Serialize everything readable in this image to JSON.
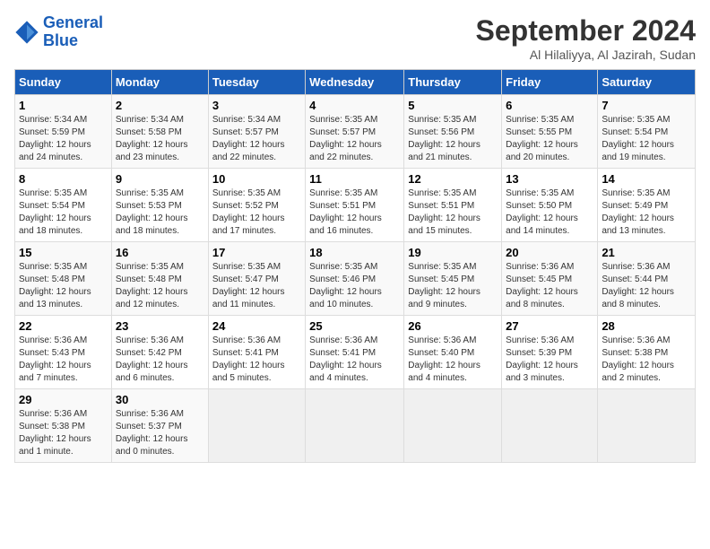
{
  "logo": {
    "line1": "General",
    "line2": "Blue"
  },
  "title": "September 2024",
  "location": "Al Hilaliyya, Al Jazirah, Sudan",
  "weekdays": [
    "Sunday",
    "Monday",
    "Tuesday",
    "Wednesday",
    "Thursday",
    "Friday",
    "Saturday"
  ],
  "weeks": [
    [
      {
        "day": "1",
        "info": "Sunrise: 5:34 AM\nSunset: 5:59 PM\nDaylight: 12 hours\nand 24 minutes."
      },
      {
        "day": "2",
        "info": "Sunrise: 5:34 AM\nSunset: 5:58 PM\nDaylight: 12 hours\nand 23 minutes."
      },
      {
        "day": "3",
        "info": "Sunrise: 5:34 AM\nSunset: 5:57 PM\nDaylight: 12 hours\nand 22 minutes."
      },
      {
        "day": "4",
        "info": "Sunrise: 5:35 AM\nSunset: 5:57 PM\nDaylight: 12 hours\nand 22 minutes."
      },
      {
        "day": "5",
        "info": "Sunrise: 5:35 AM\nSunset: 5:56 PM\nDaylight: 12 hours\nand 21 minutes."
      },
      {
        "day": "6",
        "info": "Sunrise: 5:35 AM\nSunset: 5:55 PM\nDaylight: 12 hours\nand 20 minutes."
      },
      {
        "day": "7",
        "info": "Sunrise: 5:35 AM\nSunset: 5:54 PM\nDaylight: 12 hours\nand 19 minutes."
      }
    ],
    [
      {
        "day": "8",
        "info": "Sunrise: 5:35 AM\nSunset: 5:54 PM\nDaylight: 12 hours\nand 18 minutes."
      },
      {
        "day": "9",
        "info": "Sunrise: 5:35 AM\nSunset: 5:53 PM\nDaylight: 12 hours\nand 18 minutes."
      },
      {
        "day": "10",
        "info": "Sunrise: 5:35 AM\nSunset: 5:52 PM\nDaylight: 12 hours\nand 17 minutes."
      },
      {
        "day": "11",
        "info": "Sunrise: 5:35 AM\nSunset: 5:51 PM\nDaylight: 12 hours\nand 16 minutes."
      },
      {
        "day": "12",
        "info": "Sunrise: 5:35 AM\nSunset: 5:51 PM\nDaylight: 12 hours\nand 15 minutes."
      },
      {
        "day": "13",
        "info": "Sunrise: 5:35 AM\nSunset: 5:50 PM\nDaylight: 12 hours\nand 14 minutes."
      },
      {
        "day": "14",
        "info": "Sunrise: 5:35 AM\nSunset: 5:49 PM\nDaylight: 12 hours\nand 13 minutes."
      }
    ],
    [
      {
        "day": "15",
        "info": "Sunrise: 5:35 AM\nSunset: 5:48 PM\nDaylight: 12 hours\nand 13 minutes."
      },
      {
        "day": "16",
        "info": "Sunrise: 5:35 AM\nSunset: 5:48 PM\nDaylight: 12 hours\nand 12 minutes."
      },
      {
        "day": "17",
        "info": "Sunrise: 5:35 AM\nSunset: 5:47 PM\nDaylight: 12 hours\nand 11 minutes."
      },
      {
        "day": "18",
        "info": "Sunrise: 5:35 AM\nSunset: 5:46 PM\nDaylight: 12 hours\nand 10 minutes."
      },
      {
        "day": "19",
        "info": "Sunrise: 5:35 AM\nSunset: 5:45 PM\nDaylight: 12 hours\nand 9 minutes."
      },
      {
        "day": "20",
        "info": "Sunrise: 5:36 AM\nSunset: 5:45 PM\nDaylight: 12 hours\nand 8 minutes."
      },
      {
        "day": "21",
        "info": "Sunrise: 5:36 AM\nSunset: 5:44 PM\nDaylight: 12 hours\nand 8 minutes."
      }
    ],
    [
      {
        "day": "22",
        "info": "Sunrise: 5:36 AM\nSunset: 5:43 PM\nDaylight: 12 hours\nand 7 minutes."
      },
      {
        "day": "23",
        "info": "Sunrise: 5:36 AM\nSunset: 5:42 PM\nDaylight: 12 hours\nand 6 minutes."
      },
      {
        "day": "24",
        "info": "Sunrise: 5:36 AM\nSunset: 5:41 PM\nDaylight: 12 hours\nand 5 minutes."
      },
      {
        "day": "25",
        "info": "Sunrise: 5:36 AM\nSunset: 5:41 PM\nDaylight: 12 hours\nand 4 minutes."
      },
      {
        "day": "26",
        "info": "Sunrise: 5:36 AM\nSunset: 5:40 PM\nDaylight: 12 hours\nand 4 minutes."
      },
      {
        "day": "27",
        "info": "Sunrise: 5:36 AM\nSunset: 5:39 PM\nDaylight: 12 hours\nand 3 minutes."
      },
      {
        "day": "28",
        "info": "Sunrise: 5:36 AM\nSunset: 5:38 PM\nDaylight: 12 hours\nand 2 minutes."
      }
    ],
    [
      {
        "day": "29",
        "info": "Sunrise: 5:36 AM\nSunset: 5:38 PM\nDaylight: 12 hours\nand 1 minute."
      },
      {
        "day": "30",
        "info": "Sunrise: 5:36 AM\nSunset: 5:37 PM\nDaylight: 12 hours\nand 0 minutes."
      },
      {
        "day": "",
        "info": ""
      },
      {
        "day": "",
        "info": ""
      },
      {
        "day": "",
        "info": ""
      },
      {
        "day": "",
        "info": ""
      },
      {
        "day": "",
        "info": ""
      }
    ]
  ]
}
